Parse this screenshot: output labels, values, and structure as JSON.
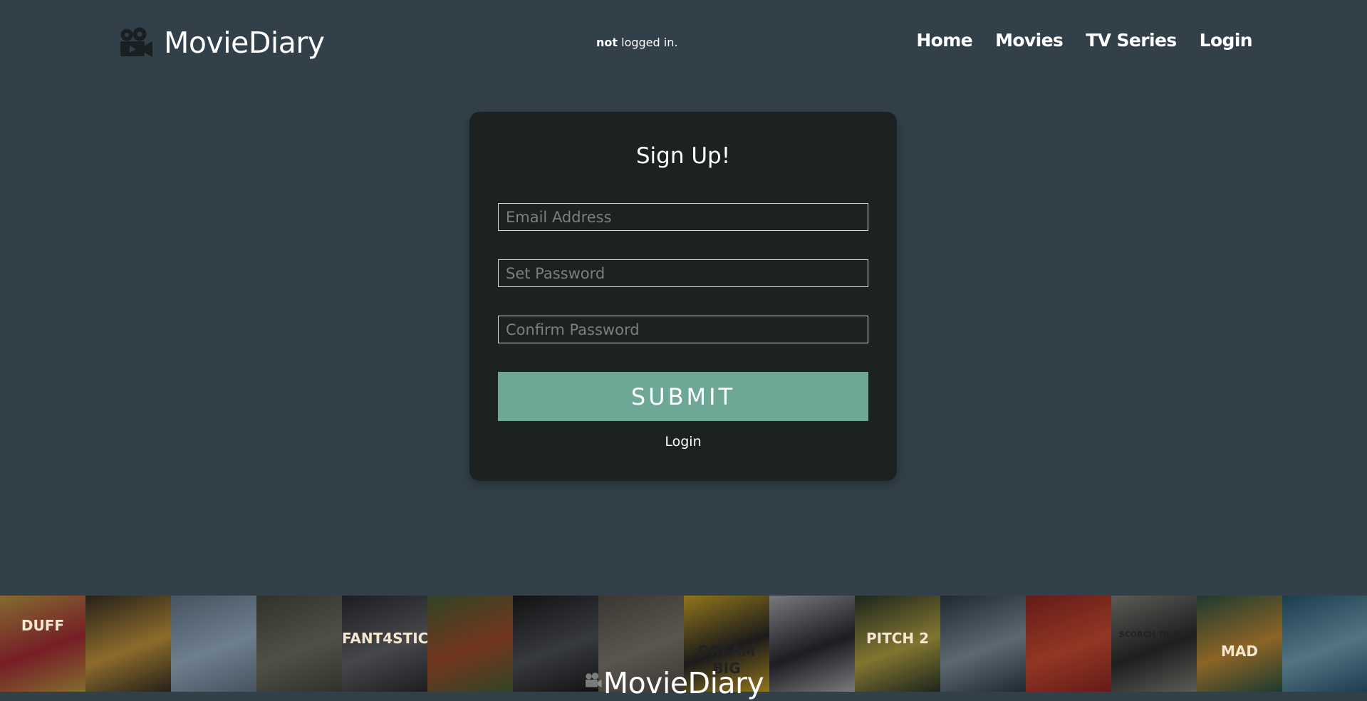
{
  "header": {
    "brand_name": "MovieDiary",
    "brand_icon": "film-camera-icon",
    "status_bold": "not",
    "status_rest": " logged in.",
    "nav": [
      {
        "label": "Home"
      },
      {
        "label": "Movies"
      },
      {
        "label": "TV Series"
      },
      {
        "label": "Login"
      }
    ]
  },
  "form": {
    "title": "Sign Up!",
    "email_placeholder": "Email Address",
    "password_placeholder": "Set Password",
    "confirm_placeholder": "Confirm Password",
    "submit_label": "SUBMIT",
    "login_link": "Login"
  },
  "footer": {
    "title": "MovieDiary",
    "posters": [
      {
        "bg": "#c9a64a",
        "accent": "#b62f3c",
        "text": "DUFF"
      },
      {
        "bg": "#3a3428",
        "accent": "#d9a544",
        "text": ""
      },
      {
        "bg": "#6d8196",
        "accent": "#a9c3d8",
        "text": ""
      },
      {
        "bg": "#4b4f44",
        "accent": "#7a7d6c",
        "text": ""
      },
      {
        "bg": "#2c2f33",
        "accent": "#6b6e72",
        "text": "FANT4STIC"
      },
      {
        "bg": "#4d6a3b",
        "accent": "#b0542f",
        "text": ""
      },
      {
        "bg": "#1c1d1f",
        "accent": "#555a5f",
        "text": ""
      },
      {
        "bg": "#5a564f",
        "accent": "#8b857a",
        "text": ""
      },
      {
        "bg": "#e0b52a",
        "accent": "#2a2a2a",
        "text": "DREAM BIG"
      },
      {
        "bg": "#b9bcc0",
        "accent": "#2b2d36",
        "text": ""
      },
      {
        "bg": "#2d3b2f",
        "accent": "#c7b44a",
        "text": "PITCH 2"
      },
      {
        "bg": "#31404d",
        "accent": "#8fa2ae",
        "text": ""
      },
      {
        "bg": "#9c2b25",
        "accent": "#e05537",
        "text": ""
      },
      {
        "bg": "#8f8c84",
        "accent": "#2f2f2f",
        "text": "SCORCH TRIALS"
      },
      {
        "bg": "#2d5b4a",
        "accent": "#d79a3a",
        "text": "MAD"
      },
      {
        "bg": "#2c5f78",
        "accent": "#7fb3c9",
        "text": ""
      },
      {
        "bg": "#2a4e63",
        "accent": "#4f86a0",
        "text": ""
      }
    ]
  }
}
